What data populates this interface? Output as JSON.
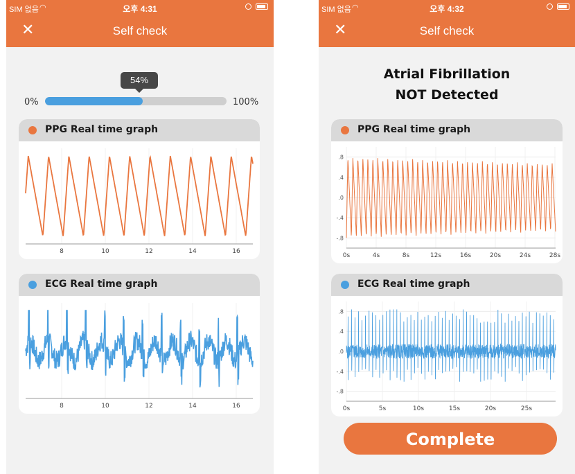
{
  "screens": [
    {
      "status": {
        "carrier": "SIM 없음",
        "time": "오후 4:31"
      },
      "nav": {
        "title": "Self check",
        "close_icon": "close-icon"
      },
      "progress": {
        "tooltip": "54%",
        "value": 54,
        "min_label": "0%",
        "max_label": "100%",
        "fill_color": "#4a9fdf"
      },
      "ppg": {
        "label": "PPG Real time graph",
        "color": "#e9763f",
        "x_ticks": [
          "8",
          "10",
          "12",
          "14",
          "16"
        ]
      },
      "ecg": {
        "label": "ECG Real time graph",
        "color": "#4a9fdf",
        "x_ticks": [
          "8",
          "10",
          "12",
          "14",
          "16"
        ]
      }
    },
    {
      "status": {
        "carrier": "SIM 없음",
        "time": "오후 4:32"
      },
      "nav": {
        "title": "Self check",
        "close_icon": "close-icon"
      },
      "result": {
        "line1": "Atrial Fibrillation",
        "line2": "NOT Detected"
      },
      "ppg": {
        "label": "PPG Real time graph",
        "color": "#e9763f",
        "y_ticks": [
          ".8",
          ".4",
          ".0",
          "-.4",
          "-.8"
        ],
        "x_ticks": [
          "0s",
          "4s",
          "8s",
          "12s",
          "16s",
          "20s",
          "24s",
          "28s"
        ]
      },
      "ecg": {
        "label": "ECG Real time graph",
        "color": "#4a9fdf",
        "y_ticks": [
          ".8",
          ".4",
          ".0",
          "-.4",
          "-.8"
        ],
        "x_ticks": [
          "0s",
          "5s",
          "10s",
          "15s",
          "20s",
          "25s"
        ]
      },
      "complete_label": "Complete"
    }
  ],
  "theme": {
    "accent": "#e9763f",
    "card_header": "#d9d9d9",
    "background": "#f2f2f2"
  }
}
